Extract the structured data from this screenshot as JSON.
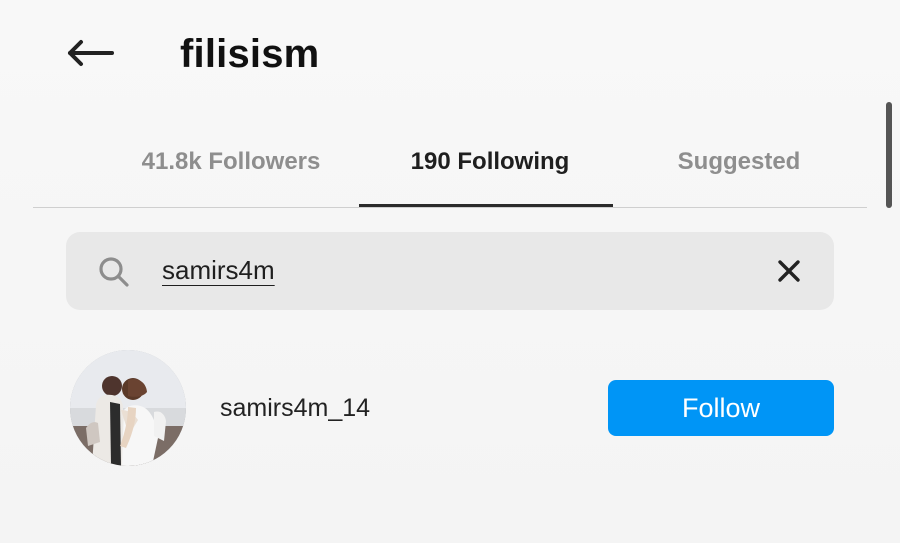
{
  "header": {
    "title": "filisism"
  },
  "tabs": [
    {
      "label": "41.8k Followers"
    },
    {
      "label": "190 Following"
    },
    {
      "label": "Suggested"
    }
  ],
  "search": {
    "value": "samirs4m",
    "placeholder": ""
  },
  "results": [
    {
      "username": "samirs4m_14",
      "button_label": "Follow"
    }
  ],
  "colors": {
    "background": "#f7f7f7",
    "search_bg": "#e8e8e8",
    "active_text": "#1f1f1f",
    "inactive_text": "#8e8e8e",
    "follow_button": "#0095f6"
  },
  "icons": {
    "back": "arrow-left-icon",
    "search": "search-icon",
    "clear": "close-icon"
  }
}
